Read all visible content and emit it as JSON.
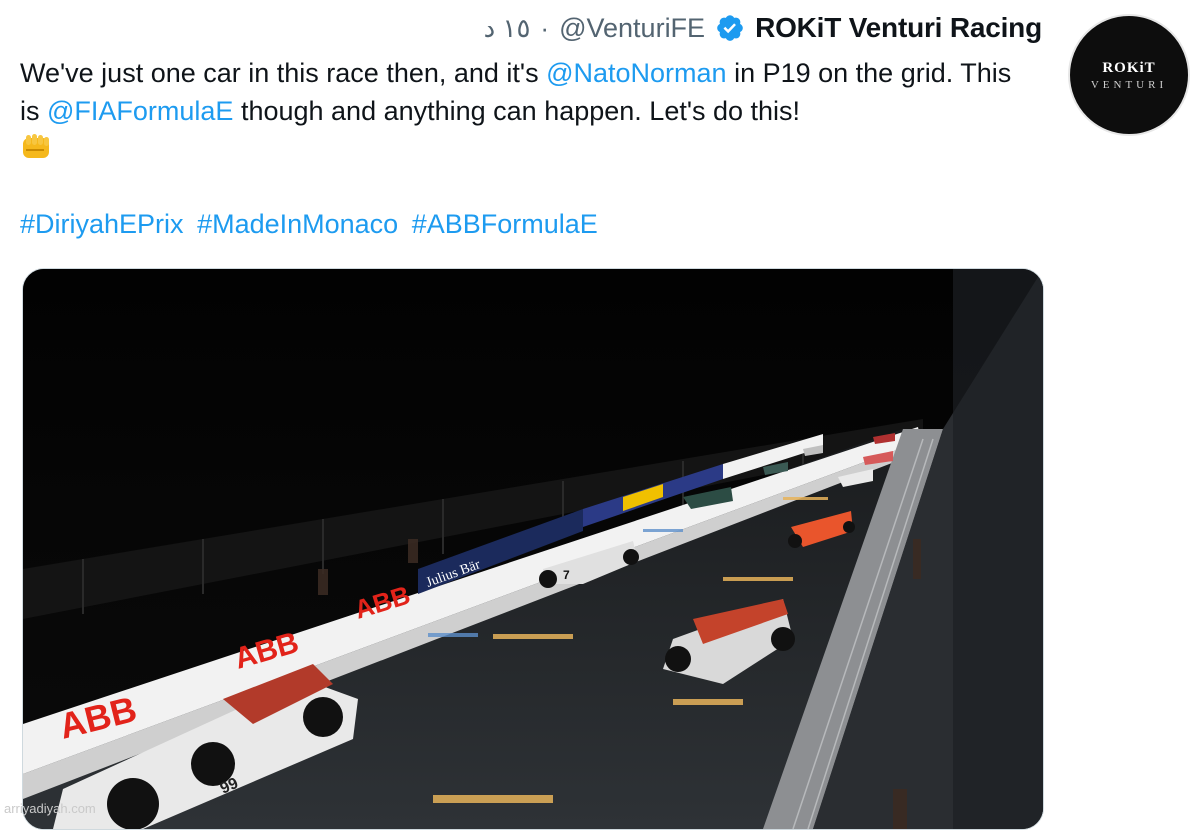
{
  "tweet": {
    "time": "١٥ د",
    "separator": "·",
    "handle": "@VenturiFE",
    "display_name": "ROKiT Venturi Racing",
    "avatar": {
      "line1": "ROKiT",
      "line2": "VENTURI"
    },
    "text": {
      "part1": "We've just one car in this race then, and it's ",
      "mention1": "@NatoNorman",
      "part2": " in P19 on the grid. This is ",
      "mention2": "@FIAFormulaE",
      "part3": " though and anything can happen. Let's do this!"
    },
    "hashtags": [
      "#DiriyahEPrix",
      "#MadeInMonaco",
      "#ABBFormulaE"
    ],
    "media": {
      "banner_ad": "ABB",
      "banner_sponsor": "Julius Bär",
      "car_numbers": [
        "99",
        "7"
      ]
    }
  },
  "watermark": "arriyadiyah.com",
  "colors": {
    "link": "#1d9bf0",
    "verified": "#1d9bf0",
    "abb_red": "#e2231a"
  }
}
